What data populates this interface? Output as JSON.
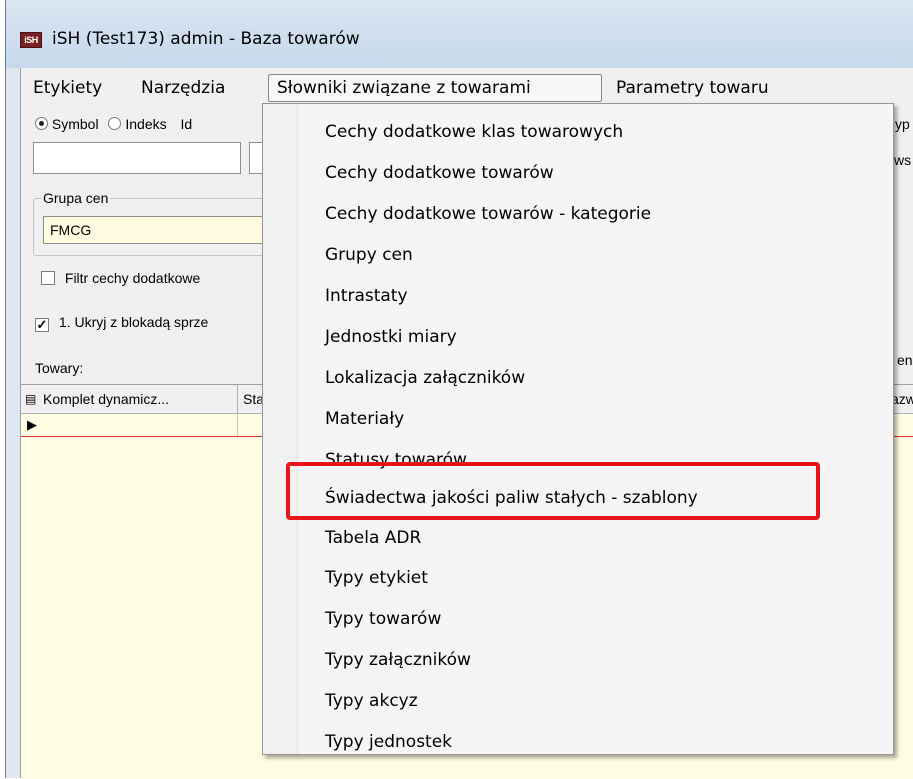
{
  "window": {
    "title": "iSH (Test173) admin - Baza towarów",
    "app_icon": "iSH"
  },
  "menubar": {
    "items": [
      "Etykiety",
      "Narzędzia",
      "Słowniki związane z towarami",
      "Parametry towaru"
    ],
    "active": "Słowniki związane z towarami"
  },
  "search": {
    "radio_symbol": "Symbol",
    "radio_indeks": "Indeks",
    "radio_id_partial": "Id",
    "typ_partial": "yp",
    "kws_partial": "kws"
  },
  "price_group": {
    "label": "Grupa cen",
    "value": "FMCG"
  },
  "filters": {
    "filtr_cechy": "Filtr cechy dodatkowe",
    "ukryj": "1. Ukryj z blokadą sprze"
  },
  "products": {
    "label": "Towary:",
    "right_partial": "enia",
    "columns": [
      "Komplet dynamicz...",
      "Sta",
      "azw"
    ]
  },
  "dropdown": {
    "items": [
      "Cechy dodatkowe klas towarowych",
      "Cechy dodatkowe towarów",
      "Cechy dodatkowe towarów - kategorie",
      "Grupy cen",
      "Intrastaty",
      "Jednostki miary",
      "Lokalizacja załączników",
      "Materiały",
      "Statusy towarów",
      "Świadectwa jakości paliw stałych - szablony",
      "Tabela ADR",
      "Typy etykiet",
      "Typy towarów",
      "Typy załączników",
      "Typy akcyz",
      "Typy jednostek"
    ],
    "highlighted_item": "Świadectwa jakości paliw stałych - szablony"
  },
  "colors": {
    "highlight": "#e8141b",
    "grid_bg": "#fffde3",
    "input_yellow": "#fffbe1"
  }
}
